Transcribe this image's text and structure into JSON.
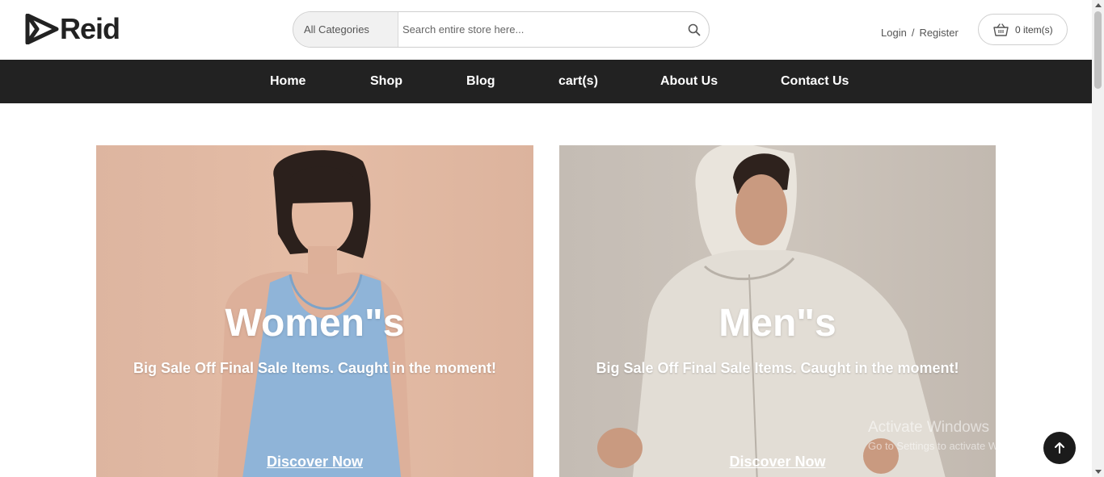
{
  "brand": {
    "name": "Reid"
  },
  "search": {
    "category_label": "All Categories",
    "placeholder": "Search entire store here..."
  },
  "account": {
    "login": "Login",
    "separator": "/",
    "register": "Register"
  },
  "cart": {
    "label": "0 item(s)"
  },
  "nav": {
    "home": "Home",
    "shop": "Shop",
    "blog": "Blog",
    "cart": "cart(s)",
    "about": "About Us",
    "contact": "Contact Us"
  },
  "banners": [
    {
      "title": "Women\"s",
      "subtitle": "Big Sale Off Final Sale Items. Caught in the moment!",
      "cta": "Discover Now"
    },
    {
      "title": "Men\"s",
      "subtitle": "Big Sale Off Final Sale Items. Caught in the moment!",
      "cta": "Discover Now"
    }
  ],
  "watermark": {
    "line1": "Activate Windows",
    "line2": "Go to Settings to activate Windows."
  },
  "colors": {
    "nav_bg": "#222222",
    "women_banner": "#e2b9a3",
    "men_banner": "#c8c0b7",
    "accent_dark": "#1b1b1b"
  },
  "icons": {
    "search": "search-icon",
    "cart": "basket-icon",
    "back_to_top": "arrow-up-icon"
  }
}
